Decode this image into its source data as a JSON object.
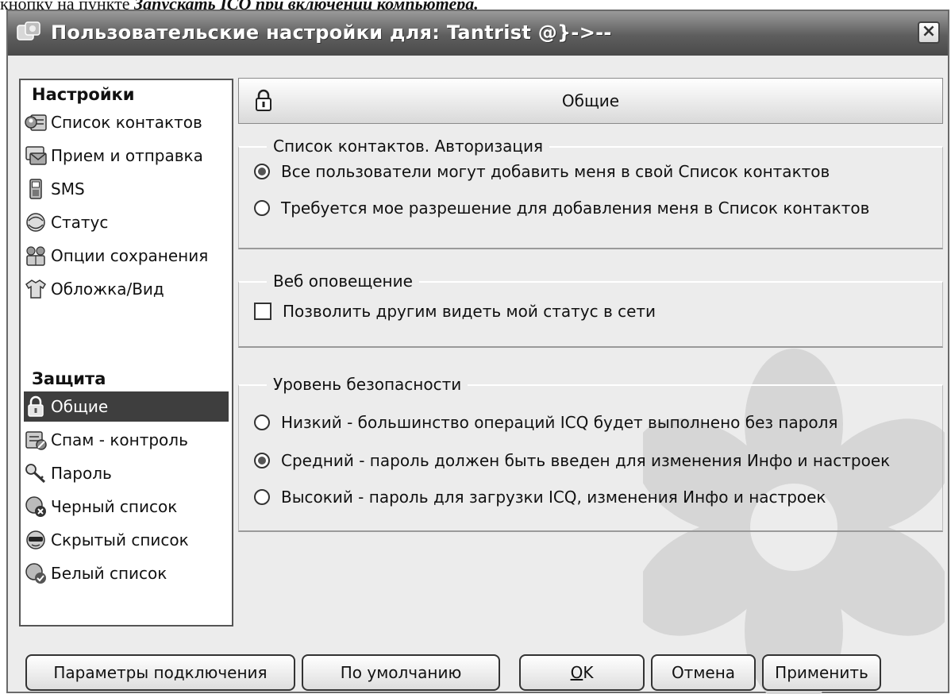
{
  "caption": {
    "prefix": "кнопку на пункте ",
    "emphasis": "Запускать ICQ при включении компьютера."
  },
  "window": {
    "title": "Пользовательские настройки для: Tantrist @}->--",
    "close_symbol": "×"
  },
  "nav": {
    "settings_header": "Настройки",
    "settings_items": [
      {
        "label": "Список контактов",
        "icon": "contacts-icon"
      },
      {
        "label": "Прием и отправка",
        "icon": "send-receive-icon"
      },
      {
        "label": "SMS",
        "icon": "phone-icon"
      },
      {
        "label": "Статус",
        "icon": "status-icon"
      },
      {
        "label": "Опции сохранения",
        "icon": "save-options-icon"
      },
      {
        "label": "Обложка/Вид",
        "icon": "skin-icon"
      }
    ],
    "security_header": "Защита",
    "security_items": [
      {
        "label": "Общие",
        "icon": "lock-icon",
        "selected": true
      },
      {
        "label": "Спам - контроль",
        "icon": "spam-icon"
      },
      {
        "label": "Пароль",
        "icon": "key-icon"
      },
      {
        "label": "Черный список",
        "icon": "blacklist-icon"
      },
      {
        "label": "Скрытый список",
        "icon": "hidden-list-icon"
      },
      {
        "label": "Белый список",
        "icon": "whitelist-icon"
      }
    ]
  },
  "panel": {
    "title": "Общие",
    "groups": [
      {
        "label": "Список контактов. Авторизация",
        "options": [
          {
            "label": "Все пользователи могут добавить меня в свой Список контактов",
            "type": "radio",
            "checked": true
          },
          {
            "label": "Требуется мое разрешение для добавления меня в Список контактов",
            "type": "radio",
            "checked": false
          }
        ]
      },
      {
        "label": "Веб оповещение",
        "options": [
          {
            "label": "Позволить другим видеть мой статус в сети",
            "type": "checkbox",
            "checked": false
          }
        ]
      },
      {
        "label": "Уровень безопасности",
        "options": [
          {
            "label": "Низкий - большинство операций ICQ будет выполнено без пароля",
            "type": "radio",
            "checked": false
          },
          {
            "label": "Средний - пароль должен быть введен для изменения Инфо и настроек",
            "type": "radio",
            "checked": true
          },
          {
            "label": "Высокий - пароль для загрузки ICQ, изменения Инфо и настроек",
            "type": "radio",
            "checked": false
          }
        ]
      }
    ]
  },
  "buttons": {
    "connection": "Параметры подключения",
    "defaults": "По умолчанию",
    "ok_mnemonic": "О",
    "ok_rest": "K",
    "cancel": "Отмена",
    "apply": "Применить"
  }
}
